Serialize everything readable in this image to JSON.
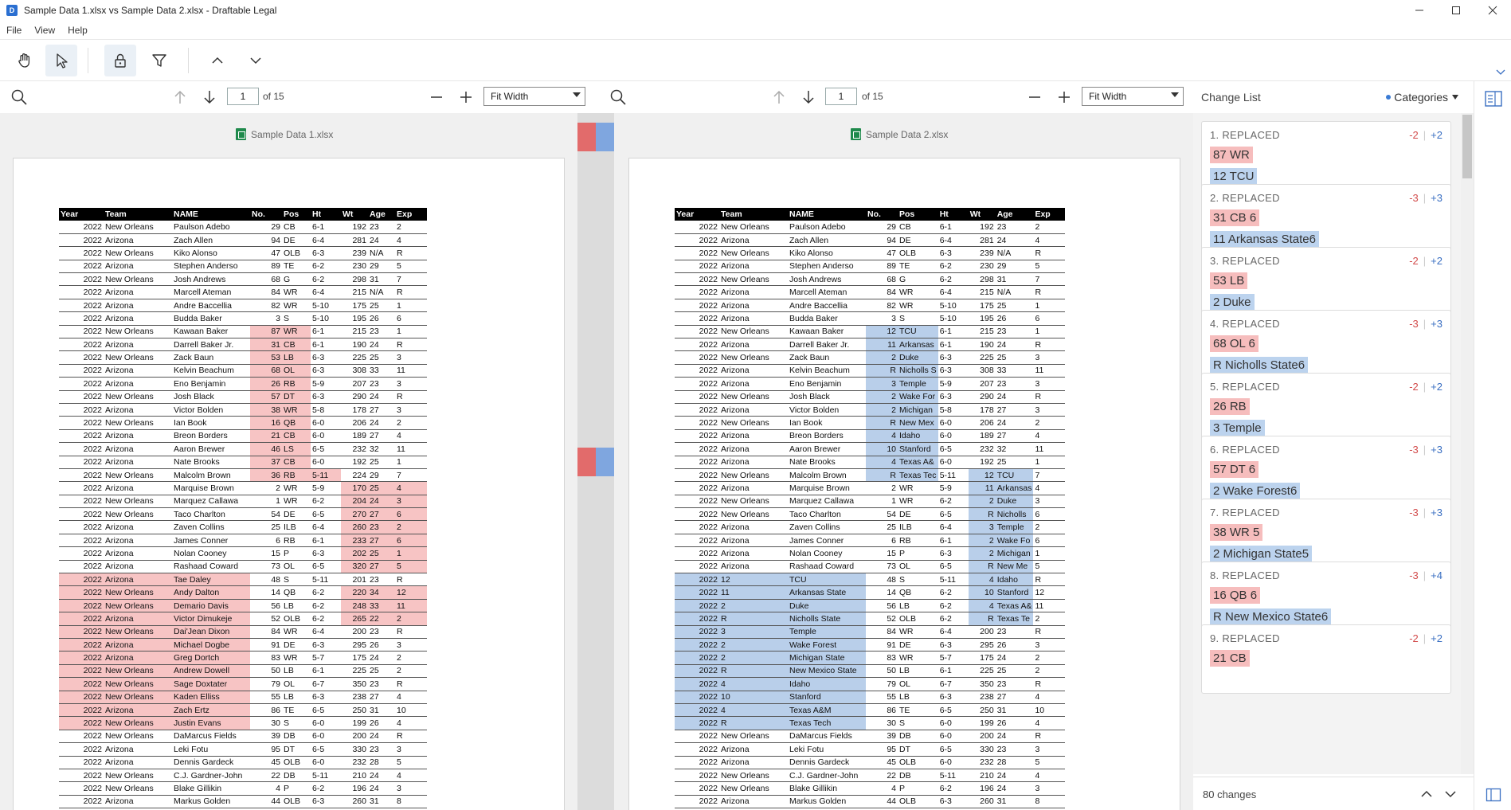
{
  "window": {
    "title": "Sample Data 1.xlsx vs Sample Data 2.xlsx - Draftable Legal"
  },
  "menu": [
    "File",
    "View",
    "Help"
  ],
  "left_pane": {
    "page": "1",
    "of": "of 15",
    "fit": "Fit Width",
    "filename": "Sample Data 1.xlsx"
  },
  "right_pane": {
    "page": "1",
    "of": "of 15",
    "fit": "Fit Width",
    "filename": "Sample Data 2.xlsx"
  },
  "headers": [
    "Year",
    "Team",
    "NAME",
    "No.",
    "Pos",
    "Ht",
    "Wt",
    "Age",
    "Exp"
  ],
  "left_rows": [
    [
      "2022",
      "New Orleans",
      "Paulson Adebo",
      "29",
      "CB",
      "6-1",
      "192",
      "23",
      "2"
    ],
    [
      "2022",
      "Arizona",
      "Zach Allen",
      "94",
      "DE",
      "6-4",
      "281",
      "24",
      "4"
    ],
    [
      "2022",
      "New Orleans",
      "Kiko Alonso",
      "47",
      "OLB",
      "6-3",
      "239",
      "N/A",
      "R"
    ],
    [
      "2022",
      "Arizona",
      "Stephen Anderso",
      "89",
      "TE",
      "6-2",
      "230",
      "29",
      "5"
    ],
    [
      "2022",
      "New Orleans",
      "Josh Andrews",
      "68",
      "G",
      "6-2",
      "298",
      "31",
      "7"
    ],
    [
      "2022",
      "Arizona",
      "Marcell Ateman",
      "84",
      "WR",
      "6-4",
      "215",
      "N/A",
      "R"
    ],
    [
      "2022",
      "Arizona",
      "Andre Baccellia",
      "82",
      "WR",
      "5-10",
      "175",
      "25",
      "1"
    ],
    [
      "2022",
      "Arizona",
      "Budda Baker",
      "3",
      "S",
      "5-10",
      "195",
      "26",
      "6"
    ],
    [
      "2022",
      "New Orleans",
      "Kawaan Baker",
      "87",
      "WR",
      "6-1",
      "215",
      "23",
      "1"
    ],
    [
      "2022",
      "Arizona",
      "Darrell Baker Jr.",
      "31",
      "CB",
      "6-1",
      "190",
      "24",
      "R"
    ],
    [
      "2022",
      "New Orleans",
      "Zack Baun",
      "53",
      "LB",
      "6-3",
      "225",
      "25",
      "3"
    ],
    [
      "2022",
      "Arizona",
      "Kelvin Beachum",
      "68",
      "OL",
      "6-3",
      "308",
      "33",
      "11"
    ],
    [
      "2022",
      "Arizona",
      "Eno Benjamin",
      "26",
      "RB",
      "5-9",
      "207",
      "23",
      "3"
    ],
    [
      "2022",
      "New Orleans",
      "Josh Black",
      "57",
      "DT",
      "6-3",
      "290",
      "24",
      "R"
    ],
    [
      "2022",
      "Arizona",
      "Victor Bolden",
      "38",
      "WR",
      "5-8",
      "178",
      "27",
      "3"
    ],
    [
      "2022",
      "New Orleans",
      "Ian Book",
      "16",
      "QB",
      "6-0",
      "206",
      "24",
      "2"
    ],
    [
      "2022",
      "Arizona",
      "Breon Borders",
      "21",
      "CB",
      "6-0",
      "189",
      "27",
      "4"
    ],
    [
      "2022",
      "Arizona",
      "Aaron Brewer",
      "46",
      "LS",
      "6-5",
      "232",
      "32",
      "11"
    ],
    [
      "2022",
      "Arizona",
      "Nate Brooks",
      "37",
      "CB",
      "6-0",
      "192",
      "25",
      "1"
    ],
    [
      "2022",
      "New Orleans",
      "Malcolm Brown",
      "36",
      "RB",
      "5-11",
      "224",
      "29",
      "7"
    ],
    [
      "2022",
      "Arizona",
      "Marquise Brown",
      "2",
      "WR",
      "5-9",
      "170",
      "25",
      "4"
    ],
    [
      "2022",
      "New Orleans",
      "Marquez Callawa",
      "1",
      "WR",
      "6-2",
      "204",
      "24",
      "3"
    ],
    [
      "2022",
      "New Orleans",
      "Taco Charlton",
      "54",
      "DE",
      "6-5",
      "270",
      "27",
      "6"
    ],
    [
      "2022",
      "Arizona",
      "Zaven Collins",
      "25",
      "ILB",
      "6-4",
      "260",
      "23",
      "2"
    ],
    [
      "2022",
      "Arizona",
      "James Conner",
      "6",
      "RB",
      "6-1",
      "233",
      "27",
      "6"
    ],
    [
      "2022",
      "Arizona",
      "Nolan Cooney",
      "15",
      "P",
      "6-3",
      "202",
      "25",
      "1"
    ],
    [
      "2022",
      "Arizona",
      "Rashaad Coward",
      "73",
      "OL",
      "6-5",
      "320",
      "27",
      "5"
    ],
    [
      "2022",
      "Arizona",
      "Tae Daley",
      "48",
      "S",
      "5-11",
      "201",
      "23",
      "R"
    ],
    [
      "2022",
      "New Orleans",
      "Andy Dalton",
      "14",
      "QB",
      "6-2",
      "220",
      "34",
      "12"
    ],
    [
      "2022",
      "New Orleans",
      "Demario Davis",
      "56",
      "LB",
      "6-2",
      "248",
      "33",
      "11"
    ],
    [
      "2022",
      "Arizona",
      "Victor Dimukeje",
      "52",
      "OLB",
      "6-2",
      "265",
      "22",
      "2"
    ],
    [
      "2022",
      "New Orleans",
      "Dai'Jean Dixon",
      "84",
      "WR",
      "6-4",
      "200",
      "23",
      "R"
    ],
    [
      "2022",
      "Arizona",
      "Michael Dogbe",
      "91",
      "DE",
      "6-3",
      "295",
      "26",
      "3"
    ],
    [
      "2022",
      "Arizona",
      "Greg Dortch",
      "83",
      "WR",
      "5-7",
      "175",
      "24",
      "2"
    ],
    [
      "2022",
      "New Orleans",
      "Andrew Dowell",
      "50",
      "LB",
      "6-1",
      "225",
      "25",
      "2"
    ],
    [
      "2022",
      "New Orleans",
      "Sage Doxtater",
      "79",
      "OL",
      "6-7",
      "350",
      "23",
      "R"
    ],
    [
      "2022",
      "New Orleans",
      "Kaden Elliss",
      "55",
      "LB",
      "6-3",
      "238",
      "27",
      "4"
    ],
    [
      "2022",
      "Arizona",
      "Zach Ertz",
      "86",
      "TE",
      "6-5",
      "250",
      "31",
      "10"
    ],
    [
      "2022",
      "New Orleans",
      "Justin Evans",
      "30",
      "S",
      "6-0",
      "199",
      "26",
      "4"
    ],
    [
      "2022",
      "New Orleans",
      "DaMarcus Fields",
      "39",
      "DB",
      "6-0",
      "200",
      "24",
      "R"
    ],
    [
      "2022",
      "Arizona",
      "Leki Fotu",
      "95",
      "DT",
      "6-5",
      "330",
      "23",
      "3"
    ],
    [
      "2022",
      "Arizona",
      "Dennis Gardeck",
      "45",
      "OLB",
      "6-0",
      "232",
      "28",
      "5"
    ],
    [
      "2022",
      "New Orleans",
      "C.J. Gardner-John",
      "22",
      "DB",
      "5-11",
      "210",
      "24",
      "4"
    ],
    [
      "2022",
      "New Orleans",
      "Blake Gillikin",
      "4",
      "P",
      "6-2",
      "196",
      "24",
      "3"
    ],
    [
      "2022",
      "Arizona",
      "Markus Golden",
      "44",
      "OLB",
      "6-3",
      "260",
      "31",
      "8"
    ]
  ],
  "right_rows": [
    [
      "2022",
      "New Orleans",
      "Paulson Adebo",
      "29",
      "CB",
      "6-1",
      "192",
      "23",
      "2"
    ],
    [
      "2022",
      "Arizona",
      "Zach Allen",
      "94",
      "DE",
      "6-4",
      "281",
      "24",
      "4"
    ],
    [
      "2022",
      "New Orleans",
      "Kiko Alonso",
      "47",
      "OLB",
      "6-3",
      "239",
      "N/A",
      "R"
    ],
    [
      "2022",
      "Arizona",
      "Stephen Anderso",
      "89",
      "TE",
      "6-2",
      "230",
      "29",
      "5"
    ],
    [
      "2022",
      "New Orleans",
      "Josh Andrews",
      "68",
      "G",
      "6-2",
      "298",
      "31",
      "7"
    ],
    [
      "2022",
      "Arizona",
      "Marcell Ateman",
      "84",
      "WR",
      "6-4",
      "215",
      "N/A",
      "R"
    ],
    [
      "2022",
      "Arizona",
      "Andre Baccellia",
      "82",
      "WR",
      "5-10",
      "175",
      "25",
      "1"
    ],
    [
      "2022",
      "Arizona",
      "Budda Baker",
      "3",
      "S",
      "5-10",
      "195",
      "26",
      "6"
    ],
    [
      "2022",
      "New Orleans",
      "Kawaan Baker",
      "12",
      "TCU",
      "6-1",
      "215",
      "23",
      "1"
    ],
    [
      "2022",
      "Arizona",
      "Darrell Baker Jr.",
      "11",
      "Arkansas",
      "6-1",
      "190",
      "24",
      "R"
    ],
    [
      "2022",
      "New Orleans",
      "Zack Baun",
      "2",
      "Duke",
      "6-3",
      "225",
      "25",
      "3"
    ],
    [
      "2022",
      "Arizona",
      "Kelvin Beachum",
      "R",
      "Nicholls S",
      "6-3",
      "308",
      "33",
      "11"
    ],
    [
      "2022",
      "Arizona",
      "Eno Benjamin",
      "3",
      "Temple",
      "5-9",
      "207",
      "23",
      "3"
    ],
    [
      "2022",
      "New Orleans",
      "Josh Black",
      "2",
      "Wake For",
      "6-3",
      "290",
      "24",
      "R"
    ],
    [
      "2022",
      "Arizona",
      "Victor Bolden",
      "2",
      "Michigan",
      "5-8",
      "178",
      "27",
      "3"
    ],
    [
      "2022",
      "New Orleans",
      "Ian Book",
      "R",
      "New Mex",
      "6-0",
      "206",
      "24",
      "2"
    ],
    [
      "2022",
      "Arizona",
      "Breon Borders",
      "4",
      "Idaho",
      "6-0",
      "189",
      "27",
      "4"
    ],
    [
      "2022",
      "Arizona",
      "Aaron Brewer",
      "10",
      "Stanford",
      "6-5",
      "232",
      "32",
      "11"
    ],
    [
      "2022",
      "Arizona",
      "Nate Brooks",
      "4",
      "Texas A&",
      "6-0",
      "192",
      "25",
      "1"
    ],
    [
      "2022",
      "New Orleans",
      "Malcolm Brown",
      "R",
      "Texas Tec",
      "5-11",
      "12",
      "TCU",
      "7"
    ],
    [
      "2022",
      "Arizona",
      "Marquise Brown",
      "2",
      "WR",
      "5-9",
      "11",
      "Arkansas",
      "4"
    ],
    [
      "2022",
      "New Orleans",
      "Marquez Callawa",
      "1",
      "WR",
      "6-2",
      "2",
      "Duke",
      "3"
    ],
    [
      "2022",
      "New Orleans",
      "Taco Charlton",
      "54",
      "DE",
      "6-5",
      "R",
      "Nicholls",
      "6"
    ],
    [
      "2022",
      "Arizona",
      "Zaven Collins",
      "25",
      "ILB",
      "6-4",
      "3",
      "Temple",
      "2"
    ],
    [
      "2022",
      "Arizona",
      "James Conner",
      "6",
      "RB",
      "6-1",
      "2",
      "Wake Fo",
      "6"
    ],
    [
      "2022",
      "Arizona",
      "Nolan Cooney",
      "15",
      "P",
      "6-3",
      "2",
      "Michigan",
      "1"
    ],
    [
      "2022",
      "Arizona",
      "Rashaad Coward",
      "73",
      "OL",
      "6-5",
      "R",
      "New Me",
      "5"
    ],
    [
      "2022",
      "12",
      "TCU",
      "48",
      "S",
      "5-11",
      "4",
      "Idaho",
      "R"
    ],
    [
      "2022",
      "11",
      "Arkansas State",
      "14",
      "QB",
      "6-2",
      "10",
      "Stanford",
      "12"
    ],
    [
      "2022",
      "2",
      "Duke",
      "56",
      "LB",
      "6-2",
      "4",
      "Texas A&",
      "11"
    ],
    [
      "2022",
      "R",
      "Nicholls State",
      "52",
      "OLB",
      "6-2",
      "R",
      "Texas Te",
      "2"
    ],
    [
      "2022",
      "3",
      "Temple",
      "84",
      "WR",
      "6-4",
      "200",
      "23",
      "R"
    ],
    [
      "2022",
      "2",
      "Wake Forest",
      "91",
      "DE",
      "6-3",
      "295",
      "26",
      "3"
    ],
    [
      "2022",
      "2",
      "Michigan State",
      "83",
      "WR",
      "5-7",
      "175",
      "24",
      "2"
    ],
    [
      "2022",
      "R",
      "New Mexico State",
      "50",
      "LB",
      "6-1",
      "225",
      "25",
      "2"
    ],
    [
      "2022",
      "4",
      "Idaho",
      "79",
      "OL",
      "6-7",
      "350",
      "23",
      "R"
    ],
    [
      "2022",
      "10",
      "Stanford",
      "55",
      "LB",
      "6-3",
      "238",
      "27",
      "4"
    ],
    [
      "2022",
      "4",
      "Texas A&M",
      "86",
      "TE",
      "6-5",
      "250",
      "31",
      "10"
    ],
    [
      "2022",
      "R",
      "Texas Tech",
      "30",
      "S",
      "6-0",
      "199",
      "26",
      "4"
    ],
    [
      "2022",
      "New Orleans",
      "DaMarcus Fields",
      "39",
      "DB",
      "6-0",
      "200",
      "24",
      "R"
    ],
    [
      "2022",
      "Arizona",
      "Leki Fotu",
      "95",
      "DT",
      "6-5",
      "330",
      "23",
      "3"
    ],
    [
      "2022",
      "Arizona",
      "Dennis Gardeck",
      "45",
      "OLB",
      "6-0",
      "232",
      "28",
      "5"
    ],
    [
      "2022",
      "New Orleans",
      "C.J. Gardner-John",
      "22",
      "DB",
      "5-11",
      "210",
      "24",
      "4"
    ],
    [
      "2022",
      "New Orleans",
      "Blake Gillikin",
      "4",
      "P",
      "6-2",
      "196",
      "24",
      "3"
    ],
    [
      "2022",
      "Arizona",
      "Markus Golden",
      "44",
      "OLB",
      "6-3",
      "260",
      "31",
      "8"
    ]
  ],
  "left_highlights": {
    "8": [
      3,
      4
    ],
    "9": [
      3,
      4
    ],
    "10": [
      3,
      4
    ],
    "11": [
      3,
      4
    ],
    "12": [
      3,
      4
    ],
    "13": [
      3,
      4
    ],
    "14": [
      3,
      4
    ],
    "15": [
      3,
      4
    ],
    "16": [
      3,
      4
    ],
    "17": [
      3,
      4
    ],
    "18": [
      3,
      4
    ],
    "19": [
      3,
      4,
      5
    ],
    "20": [
      6,
      7,
      8
    ],
    "21": [
      6,
      7,
      8
    ],
    "22": [
      6,
      7,
      8
    ],
    "23": [
      6,
      7,
      8
    ],
    "24": [
      6,
      7,
      8
    ],
    "25": [
      6,
      7,
      8
    ],
    "26": [
      6,
      7,
      8
    ],
    "27": [
      0,
      1,
      2
    ],
    "28": [
      0,
      1,
      2,
      6,
      7,
      8
    ],
    "29": [
      0,
      1,
      2,
      6,
      7,
      8
    ],
    "30": [
      0,
      1,
      2,
      6,
      7,
      8
    ],
    "31": [
      0,
      1,
      2
    ],
    "32": [
      0,
      1,
      2
    ],
    "33": [
      0,
      1,
      2
    ],
    "34": [
      0,
      1,
      2
    ],
    "35": [
      0,
      1,
      2
    ],
    "36": [
      0,
      1,
      2
    ],
    "37": [
      0,
      1,
      2
    ],
    "38": [
      0,
      1,
      2
    ]
  },
  "right_highlights": {
    "8": [
      3,
      4
    ],
    "9": [
      3,
      4
    ],
    "10": [
      3,
      4
    ],
    "11": [
      3,
      4
    ],
    "12": [
      3,
      4
    ],
    "13": [
      3,
      4
    ],
    "14": [
      3,
      4
    ],
    "15": [
      3,
      4
    ],
    "16": [
      3,
      4
    ],
    "17": [
      3,
      4
    ],
    "18": [
      3,
      4
    ],
    "19": [
      3,
      4,
      6,
      7
    ],
    "20": [
      6,
      7
    ],
    "21": [
      6,
      7
    ],
    "22": [
      6,
      7
    ],
    "23": [
      6,
      7
    ],
    "24": [
      6,
      7
    ],
    "25": [
      6,
      7
    ],
    "26": [
      6,
      7
    ],
    "27": [
      0,
      1,
      2,
      6,
      7
    ],
    "28": [
      0,
      1,
      2,
      6,
      7
    ],
    "29": [
      0,
      1,
      2,
      6,
      7
    ],
    "30": [
      0,
      1,
      2,
      6,
      7
    ],
    "31": [
      0,
      1,
      2
    ],
    "32": [
      0,
      1,
      2
    ],
    "33": [
      0,
      1,
      2
    ],
    "34": [
      0,
      1,
      2
    ],
    "35": [
      0,
      1,
      2
    ],
    "36": [
      0,
      1,
      2
    ],
    "37": [
      0,
      1,
      2
    ],
    "38": [
      0,
      1,
      2
    ]
  },
  "change_list": {
    "title": "Change List",
    "categories_label": "Categories",
    "footer_count": "80 changes",
    "items": [
      {
        "label": "1. REPLACED",
        "del": "-2",
        "add": "+2",
        "old": "87 WR",
        "new": "12 TCU"
      },
      {
        "label": "2. REPLACED",
        "del": "-3",
        "add": "+3",
        "old": "31 CB 6",
        "new": "11 Arkansas State6"
      },
      {
        "label": "3. REPLACED",
        "del": "-2",
        "add": "+2",
        "old": "53 LB",
        "new": "2 Duke"
      },
      {
        "label": "4. REPLACED",
        "del": "-3",
        "add": "+3",
        "old": "68 OL 6",
        "new": "R Nicholls State6"
      },
      {
        "label": "5. REPLACED",
        "del": "-2",
        "add": "+2",
        "old": "26 RB",
        "new": "3 Temple"
      },
      {
        "label": "6. REPLACED",
        "del": "-3",
        "add": "+3",
        "old": "57 DT 6",
        "new": "2 Wake Forest6"
      },
      {
        "label": "7. REPLACED",
        "del": "-3",
        "add": "+3",
        "old": "38 WR 5",
        "new": "2 Michigan State5"
      },
      {
        "label": "8. REPLACED",
        "del": "-3",
        "add": "+4",
        "old": "16 QB 6",
        "new": "R New Mexico State6"
      },
      {
        "label": "9. REPLACED",
        "del": "-2",
        "add": "+2",
        "old": "21 CB",
        "new": ""
      }
    ]
  },
  "colors": {
    "deleted": "#f7c4c4",
    "inserted": "#b9cfea",
    "accent": "#3a7bd5"
  }
}
